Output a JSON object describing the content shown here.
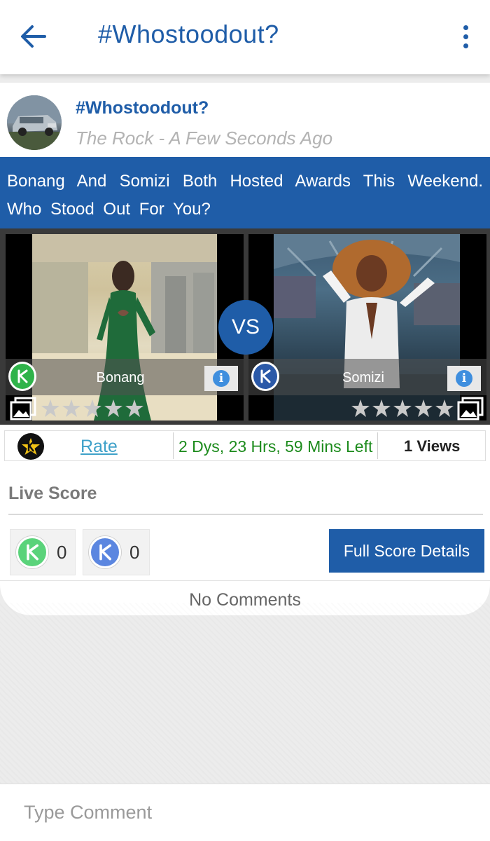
{
  "app_bar": {
    "title": "#Whostoodout?"
  },
  "post": {
    "title": "#Whostoodout?",
    "meta": "The Rock - A Few Seconds Ago",
    "question": "Bonang And Somizi Both Hosted Awards This Weekend. Who Stood Out For You?"
  },
  "versus": {
    "vs_label": "VS",
    "left": {
      "name": "Bonang",
      "team_color": "#2fb34a",
      "rating": 0,
      "max_rating": 5
    },
    "right": {
      "name": "Somizi",
      "team_color": "#2b59a8",
      "rating": 0,
      "max_rating": 5
    }
  },
  "info_row": {
    "rate_label": "Rate",
    "time_left": "2 Dys, 23 Hrs, 59 Mins Left",
    "views": "1 Views"
  },
  "live_score": {
    "title": "Live Score",
    "left_score": "0",
    "right_score": "0",
    "full_details_label": "Full Score Details"
  },
  "comments": {
    "empty_text": "No Comments",
    "input_placeholder": "Type Comment"
  },
  "colors": {
    "primary": "#1f5da8",
    "timer_green": "#1c8b1c",
    "rate_link": "#3fa1c9"
  },
  "icons": {
    "back": "arrow-left-icon",
    "more": "more-vert-icon",
    "info": "info-icon",
    "gallery": "gallery-icon",
    "star": "star-icon"
  }
}
